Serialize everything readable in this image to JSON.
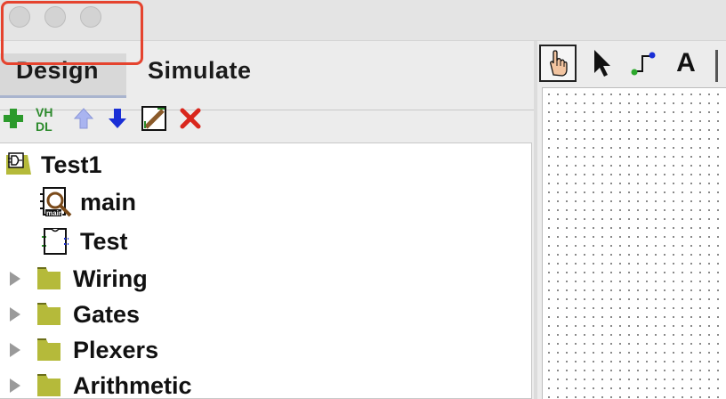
{
  "window": {
    "traffic_lights": [
      "close",
      "minimize",
      "zoom"
    ]
  },
  "tabs": [
    {
      "label": "Design",
      "active": true
    },
    {
      "label": "Simulate",
      "active": false
    }
  ],
  "toolbar": {
    "add_icon": "plus-icon",
    "vhdl_label": "VH\nDL",
    "move_up_icon": "arrow-up-icon",
    "move_down_icon": "arrow-down-icon",
    "edit_icon": "pencil-icon",
    "delete_icon": "delete-x-icon"
  },
  "tree": {
    "project": {
      "label": "Test1",
      "icon": "project-icon"
    },
    "circuits": [
      {
        "label": "main",
        "icon": "circuit-main-icon",
        "badge": "main"
      },
      {
        "label": "Test",
        "icon": "circuit-icon"
      }
    ],
    "libraries": [
      {
        "label": "Wiring"
      },
      {
        "label": "Gates"
      },
      {
        "label": "Plexers"
      },
      {
        "label": "Arithmetic"
      }
    ]
  },
  "canvas_tools": {
    "poke": "hand-poke-icon",
    "select": "pointer-icon",
    "wire": "wire-icon",
    "text_label": "A"
  },
  "colors": {
    "highlight": "#e5432e",
    "folder": "#b5ba3a",
    "add_green": "#2c9a2c",
    "down_blue": "#1a2fd6",
    "delete_red": "#d9261c"
  }
}
